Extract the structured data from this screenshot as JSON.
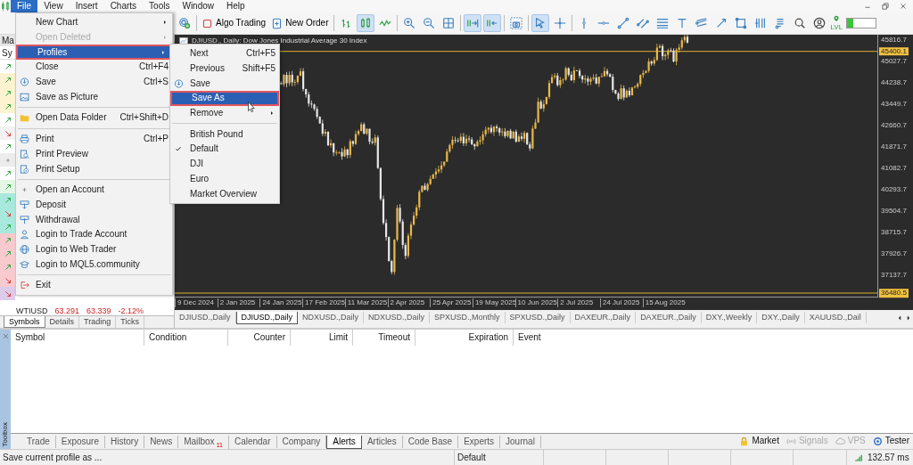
{
  "menubar": {
    "items": [
      {
        "label": "File",
        "selected": true
      },
      {
        "label": "View",
        "selected": false
      },
      {
        "label": "Insert",
        "selected": false
      },
      {
        "label": "Charts",
        "selected": false
      },
      {
        "label": "Tools",
        "selected": false
      },
      {
        "label": "Window",
        "selected": false
      },
      {
        "label": "Help",
        "selected": false
      }
    ]
  },
  "toolbar": {
    "items": [
      {
        "kind": "icon",
        "selected": false
      },
      {
        "kind": "separator"
      },
      {
        "kind": "button",
        "label": "Algo Trading"
      },
      {
        "kind": "button",
        "label": "New Order"
      },
      {
        "kind": "separator"
      },
      {
        "kind": "icon",
        "selected": false
      },
      {
        "kind": "icon",
        "selected": true
      },
      {
        "kind": "icon",
        "selected": false
      },
      {
        "kind": "separator"
      },
      {
        "kind": "icon",
        "selected": false
      },
      {
        "kind": "icon",
        "selected": false
      },
      {
        "kind": "icon",
        "selected": false
      },
      {
        "kind": "separator"
      },
      {
        "kind": "icon",
        "selected": true
      },
      {
        "kind": "icon",
        "selected": true
      },
      {
        "kind": "separator"
      },
      {
        "kind": "icon",
        "selected": false
      },
      {
        "kind": "separator"
      },
      {
        "kind": "icon",
        "selected": true
      },
      {
        "kind": "icon",
        "selected": false
      },
      {
        "kind": "separator"
      },
      {
        "kind": "icon",
        "selected": false
      },
      {
        "kind": "icon",
        "selected": false
      },
      {
        "kind": "icon",
        "selected": false
      },
      {
        "kind": "icon",
        "selected": false
      },
      {
        "kind": "icon",
        "selected": false
      },
      {
        "kind": "icon",
        "selected": false
      },
      {
        "kind": "icon",
        "selected": false
      },
      {
        "kind": "icon",
        "selected": false
      },
      {
        "kind": "icon",
        "selected": false
      },
      {
        "kind": "icon",
        "selected": false
      },
      {
        "kind": "icon",
        "selected": false
      },
      {
        "kind": "icon",
        "selected": false
      },
      {
        "kind": "icon",
        "selected": false
      },
      {
        "kind": "badge",
        "label": "LVL"
      },
      {
        "kind": "meter",
        "level": 0.22
      }
    ]
  },
  "market_watch": {
    "title": "Ma",
    "column": "Sy",
    "rows": [
      {
        "kind": "up",
        "color": "#ffffff"
      },
      {
        "kind": "up",
        "color": "#fdf3d0"
      },
      {
        "kind": "up",
        "color": "#fdf3d0"
      },
      {
        "kind": "up",
        "color": "#fdf3d0"
      },
      {
        "kind": "up",
        "color": "#ffffff"
      },
      {
        "kind": "down",
        "color": "#f2f2f2"
      },
      {
        "kind": "up",
        "color": "#ffffff"
      },
      {
        "kind": "flat",
        "color": "#ececec"
      },
      {
        "kind": "up",
        "color": "#ffffff"
      },
      {
        "kind": "up",
        "color": "#e4f6e4"
      },
      {
        "kind": "up",
        "color": "#a9e8dc"
      },
      {
        "kind": "down",
        "color": "#a9e8dc"
      },
      {
        "kind": "up",
        "color": "#a9e8dc"
      },
      {
        "kind": "up",
        "color": "#f8c9cd"
      },
      {
        "kind": "up",
        "color": "#f8c9cd"
      },
      {
        "kind": "up",
        "color": "#f8c9cd"
      },
      {
        "kind": "down",
        "color": "#f8c9cd"
      },
      {
        "kind": "down",
        "color": "#dccbea"
      }
    ],
    "last_row": {
      "symbol": "WTIUSD",
      "bid": "63.291",
      "ask": "63.339",
      "change": "-2.12%"
    },
    "tabs": [
      {
        "label": "Symbols",
        "selected": true
      },
      {
        "label": "Details",
        "selected": false
      },
      {
        "label": "Trading",
        "selected": false
      },
      {
        "label": "Ticks",
        "selected": false
      }
    ]
  },
  "chart": {
    "title": "DJIUSD., Daily: Dow Jones Industrial Average 30 Index",
    "price_labels": [
      {
        "kind": "tick",
        "label": "45816.7"
      },
      {
        "kind": "marker",
        "label": "45400.1"
      },
      {
        "kind": "tick",
        "label": "45027.7"
      },
      {
        "kind": "tick",
        "label": "44238.7"
      },
      {
        "kind": "tick",
        "label": "43449.7"
      },
      {
        "kind": "tick",
        "label": "42660.7"
      },
      {
        "kind": "tick",
        "label": "41871.7"
      },
      {
        "kind": "tick",
        "label": "41082.7"
      },
      {
        "kind": "tick",
        "label": "40293.7"
      },
      {
        "kind": "tick",
        "label": "39504.7"
      },
      {
        "kind": "tick",
        "label": "38715.7"
      },
      {
        "kind": "tick",
        "label": "37926.7"
      },
      {
        "kind": "tick",
        "label": "37137.7"
      },
      {
        "kind": "marker",
        "label": "36480.5"
      }
    ],
    "date_labels": [
      "9 Dec 2024",
      "2 Jan 2025",
      "24 Jan 2025",
      "17 Feb 2025",
      "11 Mar 2025",
      "2 Apr 2025",
      "25 Apr 2025",
      "19 May 2025",
      "10 Jun 2025",
      "2 Jul 2025",
      "24 Jul 2025",
      "15 Aug 2025"
    ]
  },
  "chart_tabs": [
    {
      "label": "DJIUSD.,Daily",
      "selected": false
    },
    {
      "label": "DJIUSD.,Daily",
      "selected": true
    },
    {
      "label": "NDXUSD.,Daily",
      "selected": false
    },
    {
      "label": "NDXUSD.,Daily",
      "selected": false
    },
    {
      "label": "SPXUSD.,Monthly",
      "selected": false
    },
    {
      "label": "SPXUSD.,Daily",
      "selected": false
    },
    {
      "label": "DAXEUR.,Daily",
      "selected": false
    },
    {
      "label": "DAXEUR.,Daily",
      "selected": false
    },
    {
      "label": "DXY.,Weekly",
      "selected": false
    },
    {
      "label": "DXY.,Daily",
      "selected": false
    },
    {
      "label": "XAUUSD.,Dail",
      "selected": false
    }
  ],
  "file_menu": {
    "items": [
      {
        "kind": "item",
        "label": "New Chart",
        "submenu": true,
        "disabled": false,
        "selected": false
      },
      {
        "kind": "item",
        "label": "Open Deleted",
        "submenu": true,
        "disabled": true,
        "selected": false
      },
      {
        "kind": "item",
        "label": "Profiles",
        "submenu": true,
        "disabled": false,
        "selected": true
      },
      {
        "kind": "item",
        "label": "Close",
        "shortcut": "Ctrl+F4",
        "submenu": false,
        "disabled": false,
        "selected": false
      },
      {
        "kind": "item",
        "label": "Save",
        "shortcut": "Ctrl+S",
        "submenu": false,
        "disabled": false,
        "selected": false
      },
      {
        "kind": "item",
        "label": "Save as Picture",
        "submenu": false,
        "disabled": false,
        "selected": false
      },
      {
        "kind": "separator"
      },
      {
        "kind": "item",
        "label": "Open Data Folder",
        "shortcut": "Ctrl+Shift+D",
        "submenu": false,
        "disabled": false,
        "selected": false
      },
      {
        "kind": "separator"
      },
      {
        "kind": "item",
        "label": "Print",
        "shortcut": "Ctrl+P",
        "submenu": false,
        "disabled": false,
        "selected": false
      },
      {
        "kind": "item",
        "label": "Print Preview",
        "submenu": false,
        "disabled": false,
        "selected": false
      },
      {
        "kind": "item",
        "label": "Print Setup",
        "submenu": false,
        "disabled": false,
        "selected": false
      },
      {
        "kind": "separator"
      },
      {
        "kind": "item",
        "label": "Open an Account",
        "submenu": false,
        "disabled": false,
        "selected": false
      },
      {
        "kind": "item",
        "label": "Deposit",
        "submenu": false,
        "disabled": false,
        "selected": false
      },
      {
        "kind": "item",
        "label": "Withdrawal",
        "submenu": false,
        "disabled": false,
        "selected": false
      },
      {
        "kind": "item",
        "label": "Login to Trade Account",
        "submenu": false,
        "disabled": false,
        "selected": false
      },
      {
        "kind": "item",
        "label": "Login to Web Trader",
        "submenu": false,
        "disabled": false,
        "selected": false
      },
      {
        "kind": "item",
        "label": "Login to MQL5.community",
        "submenu": false,
        "disabled": false,
        "selected": false
      },
      {
        "kind": "separator"
      },
      {
        "kind": "item",
        "label": "Exit",
        "submenu": false,
        "disabled": false,
        "selected": false
      }
    ]
  },
  "profiles_menu": {
    "items": [
      {
        "kind": "item",
        "label": "Next",
        "shortcut": "Ctrl+F5",
        "submenu": false,
        "checked": false,
        "selected": false
      },
      {
        "kind": "item",
        "label": "Previous",
        "shortcut": "Shift+F5",
        "submenu": false,
        "checked": false,
        "selected": false
      },
      {
        "kind": "item",
        "label": "Save",
        "submenu": false,
        "checked": false,
        "selected": false
      },
      {
        "kind": "item",
        "label": "Save As",
        "submenu": false,
        "checked": false,
        "selected": true
      },
      {
        "kind": "item",
        "label": "Remove",
        "submenu": true,
        "checked": false,
        "selected": false
      },
      {
        "kind": "separator"
      },
      {
        "kind": "item",
        "label": "British Pound",
        "submenu": false,
        "checked": false,
        "selected": false
      },
      {
        "kind": "item",
        "label": "Default",
        "submenu": false,
        "checked": true,
        "selected": false
      },
      {
        "kind": "item",
        "label": "DJI",
        "submenu": false,
        "checked": false,
        "selected": false
      },
      {
        "kind": "item",
        "label": "Euro",
        "submenu": false,
        "checked": false,
        "selected": false
      },
      {
        "kind": "item",
        "label": "Market Overview",
        "submenu": false,
        "checked": false,
        "selected": false
      }
    ]
  },
  "toolbox": {
    "title": "Toolbox",
    "columns": [
      "Symbol",
      "Condition",
      "Counter",
      "Limit",
      "Timeout",
      "Expiration",
      "Event"
    ],
    "tabs": [
      {
        "label": "Trade",
        "selected": false
      },
      {
        "label": "Exposure",
        "selected": false
      },
      {
        "label": "History",
        "selected": false
      },
      {
        "label": "News",
        "selected": false
      },
      {
        "label": "Mailbox",
        "badge": "11",
        "selected": false
      },
      {
        "label": "Calendar",
        "selected": false
      },
      {
        "label": "Company",
        "selected": false
      },
      {
        "label": "Alerts",
        "selected": true
      },
      {
        "label": "Articles",
        "selected": false
      },
      {
        "label": "Code Base",
        "selected": false
      },
      {
        "label": "Experts",
        "selected": false
      },
      {
        "label": "Journal",
        "selected": false
      }
    ],
    "services": [
      {
        "label": "Market",
        "disabled": false
      },
      {
        "label": "Signals",
        "disabled": true
      },
      {
        "label": "VPS",
        "disabled": true
      },
      {
        "label": "Tester",
        "disabled": false
      }
    ]
  },
  "status_bar": {
    "message": "Save current profile as ...",
    "profile": "Default",
    "ping": "132.57 ms"
  }
}
